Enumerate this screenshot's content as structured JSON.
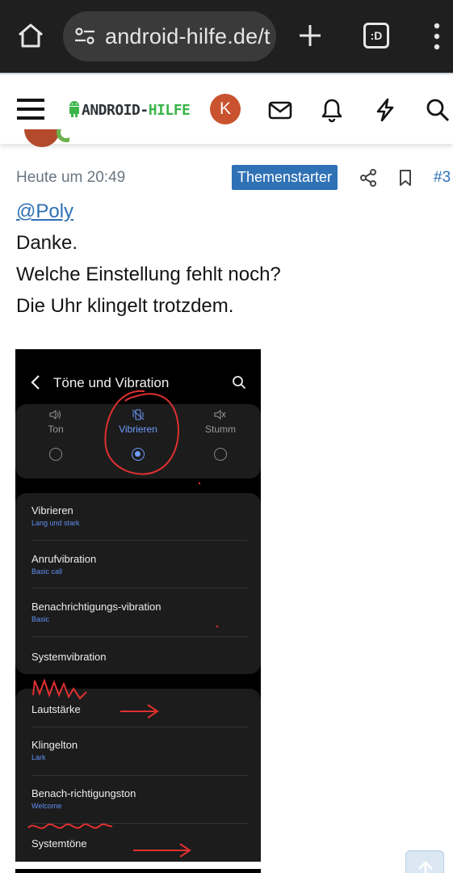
{
  "browser": {
    "url": "android-hilfe.de/t",
    "tabs_label": ":D"
  },
  "site": {
    "logo_prefix": "ANDROID-",
    "logo_suffix": "HILFE",
    "avatar_initial": "K",
    "colors": {
      "accent": "#2f71b5",
      "brand_green": "#3bb54a",
      "avatar": "#c9532e"
    }
  },
  "post": {
    "timestamp": "Heute um 20:49",
    "badge": "Themenstarter",
    "number": "#3",
    "mention": "@Poly",
    "lines": [
      "Danke.",
      "Welche Einstellung fehlt noch?",
      "Die Uhr klingelt trotzdem."
    ]
  },
  "screenshot": {
    "title": "Töne und Vibration",
    "modes": [
      {
        "label": "Ton",
        "selected": false
      },
      {
        "label": "Vibrieren",
        "selected": true
      },
      {
        "label": "Stumm",
        "selected": false
      }
    ],
    "group1": [
      {
        "title": "Vibrieren",
        "subtitle": "Lang und stark"
      },
      {
        "title": "Anrufvibration",
        "subtitle": "Basic call"
      },
      {
        "title": "Benachrichtigungs-vibration",
        "subtitle": "Basic"
      },
      {
        "title": "Systemvibration",
        "subtitle": ""
      }
    ],
    "group2": [
      {
        "title": "Lautstärke",
        "subtitle": ""
      },
      {
        "title": "Klingelton",
        "subtitle": "Lark"
      },
      {
        "title": "Benach-richtigungston",
        "subtitle": "Welcome"
      },
      {
        "title": "Systemtöne",
        "subtitle": ""
      }
    ]
  }
}
